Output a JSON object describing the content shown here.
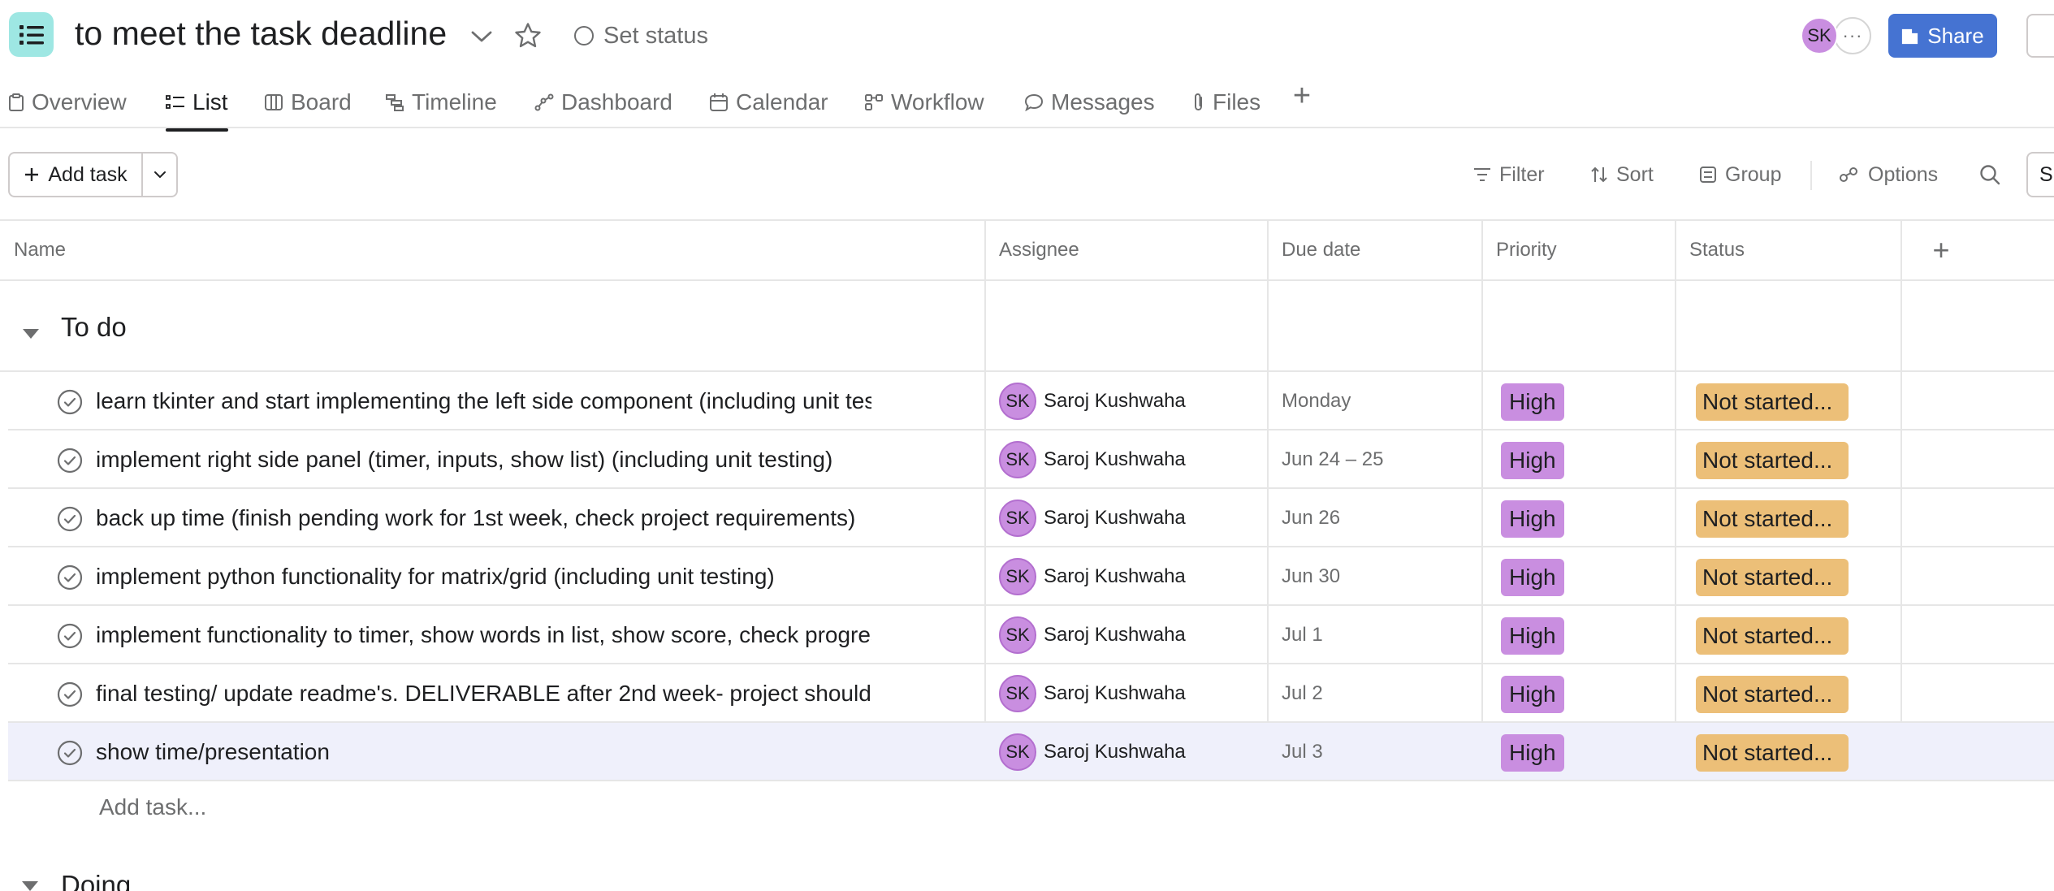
{
  "project": {
    "title": "to meet the task deadline",
    "set_status_label": "Set status",
    "avatar_initials": "SK",
    "more_label": "···",
    "share_label": "Share",
    "icon_color": "#9ee7e3"
  },
  "tabs": [
    {
      "label": "Overview",
      "icon": "clipboard-icon"
    },
    {
      "label": "List",
      "icon": "list-icon",
      "active": true
    },
    {
      "label": "Board",
      "icon": "board-icon"
    },
    {
      "label": "Timeline",
      "icon": "timeline-icon"
    },
    {
      "label": "Dashboard",
      "icon": "dashboard-icon"
    },
    {
      "label": "Calendar",
      "icon": "calendar-icon"
    },
    {
      "label": "Workflow",
      "icon": "workflow-icon"
    },
    {
      "label": "Messages",
      "icon": "chat-icon"
    },
    {
      "label": "Files",
      "icon": "paperclip-icon"
    }
  ],
  "toolbar": {
    "add_task_label": "Add task",
    "filter_label": "Filter",
    "sort_label": "Sort",
    "group_label": "Group",
    "options_label": "Options",
    "edge_search_text": "S"
  },
  "columns": [
    "Name",
    "Assignee",
    "Due date",
    "Priority",
    "Status"
  ],
  "sections": [
    {
      "title": "To do",
      "tasks": [
        {
          "name": "learn tkinter and start implementing the left side component (including unit testing)",
          "assignee": "Saroj Kushwaha",
          "initials": "SK",
          "due": "Monday",
          "priority": "High",
          "status": "Not started..."
        },
        {
          "name": "implement right side panel (timer, inputs, show list) (including unit testing)",
          "assignee": "Saroj Kushwaha",
          "initials": "SK",
          "due": "Jun 24 – 25",
          "priority": "High",
          "status": "Not started..."
        },
        {
          "name": "back up time (finish pending work for 1st week, check project requirements)",
          "assignee": "Saroj Kushwaha",
          "initials": "SK",
          "due": "Jun 26",
          "priority": "High",
          "status": "Not started..."
        },
        {
          "name": "implement python functionality for matrix/grid (including unit testing)",
          "assignee": "Saroj Kushwaha",
          "initials": "SK",
          "due": "Jun 30",
          "priority": "High",
          "status": "Not started..."
        },
        {
          "name": "implement functionality to timer, show words in list, show score, check progress",
          "assignee": "Saroj Kushwaha",
          "initials": "SK",
          "due": "Jul 1",
          "priority": "High",
          "status": "Not started..."
        },
        {
          "name": "final testing/ update readme's. DELIVERABLE after 2nd week- project should be done",
          "assignee": "Saroj Kushwaha",
          "initials": "SK",
          "due": "Jul 2",
          "priority": "High",
          "status": "Not started..."
        },
        {
          "name": "show time/presentation",
          "assignee": "Saroj Kushwaha",
          "initials": "SK",
          "due": "Jul 3",
          "priority": "High",
          "status": "Not started..."
        }
      ],
      "add_task_label": "Add task..."
    },
    {
      "title": "Doing"
    }
  ],
  "colors": {
    "accent": "#4573d2",
    "priority_high": "#c98ee0",
    "status_not_started": "#ecbf78",
    "highlight_row": "#eff0fb"
  }
}
